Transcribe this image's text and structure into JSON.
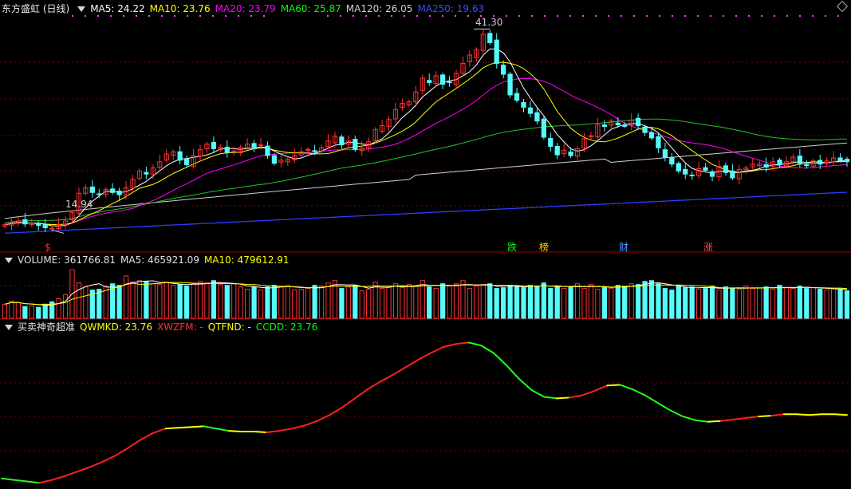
{
  "header": {
    "title": "东方盛虹 (日线)",
    "ma_labels": [
      {
        "text": "MA5: 24.22",
        "color": "#ffffff"
      },
      {
        "text": "MA10: 23.76",
        "color": "#ffff00"
      },
      {
        "text": "MA20: 23.79",
        "color": "#ff00ff"
      },
      {
        "text": "MA60: 25.87",
        "color": "#00ff00"
      },
      {
        "text": "MA120: 26.05",
        "color": "#d0d0d0"
      },
      {
        "text": "MA250: 19.63",
        "color": "#3a4bff"
      }
    ]
  },
  "volume_header": {
    "labels": [
      {
        "text": "VOLUME: 361766.81",
        "color": "#e0e0e0"
      },
      {
        "text": "MA5: 465921.09",
        "color": "#e0e0e0"
      },
      {
        "text": "MA10: 479612.91",
        "color": "#ffff00"
      }
    ]
  },
  "indicator_header": {
    "title": "买卖神奇超准",
    "labels": [
      {
        "text": "QWMKD: 23.76",
        "color": "#ffff00"
      },
      {
        "text": "XWZFM: -",
        "color": "#ff3030"
      },
      {
        "text": "QTFND: -",
        "color": "#ffff00"
      },
      {
        "text": "CCDD: 23.76",
        "color": "#00ff00"
      }
    ]
  },
  "annotations": {
    "high": "41.30",
    "low": "14.94"
  },
  "event_marks": [
    {
      "text": "$",
      "color": "#ff3030"
    },
    {
      "text": "跌",
      "color": "#00ff00"
    },
    {
      "text": "榜",
      "color": "#ffd700"
    },
    {
      "text": "财",
      "color": "#4aa0ff"
    },
    {
      "text": "涨",
      "color": "#ff5050"
    }
  ],
  "colors": {
    "up": "#ff3232",
    "down": "#54fcfc",
    "grid": "#800000"
  },
  "chart_data": {
    "type": "candlestick",
    "ylim": [
      13.5,
      43
    ],
    "closes": [
      15.4,
      15.7,
      15.9,
      15.5,
      15.6,
      15.3,
      15.0,
      14.95,
      15.4,
      15.9,
      17.0,
      19.5,
      20.2,
      19.6,
      19.4,
      20.0,
      19.6,
      19.3,
      20.2,
      21.3,
      22.4,
      22.0,
      22.8,
      23.6,
      24.6,
      24.9,
      23.8,
      23.2,
      24.4,
      25.2,
      25.9,
      25.3,
      25.5,
      24.8,
      25.0,
      25.5,
      25.9,
      25.5,
      25.8,
      24.4,
      23.4,
      23.8,
      23.9,
      24.4,
      24.9,
      25.2,
      25.0,
      25.4,
      26.3,
      26.9,
      25.8,
      26.3,
      25.2,
      25.4,
      26.2,
      27.8,
      28.3,
      29.1,
      30.4,
      31.2,
      31.4,
      32.7,
      34.5,
      33.9,
      34.8,
      33.7,
      33.9,
      35.1,
      36.4,
      37.5,
      38.2,
      40.2,
      39.1,
      36.4,
      35.0,
      32.3,
      31.6,
      30.7,
      29.9,
      28.9,
      26.8,
      25.6,
      24.5,
      25.1,
      24.4,
      25.3,
      26.6,
      27.0,
      28.4,
      28.2,
      28.9,
      28.4,
      28.3,
      29.0,
      28.3,
      27.4,
      26.7,
      25.4,
      24.2,
      23.3,
      22.4,
      22.0,
      21.8,
      22.7,
      22.5,
      21.7,
      23.0,
      22.2,
      21.5,
      22.6,
      22.8,
      23.3,
      23.3,
      22.9,
      23.6,
      23.2,
      23.6,
      24.2,
      23.4,
      23.1,
      23.7,
      23.3,
      23.7,
      24.1,
      23.8,
      23.6
    ],
    "volume": [
      18,
      22,
      20,
      15,
      16,
      14,
      18,
      21,
      25,
      30,
      62,
      45,
      40,
      36,
      37,
      41,
      44,
      42,
      54,
      46,
      48,
      47,
      44,
      43,
      46,
      42,
      43,
      41,
      45,
      47,
      45,
      48,
      43,
      42,
      44,
      40,
      37,
      40,
      36,
      40,
      42,
      41,
      42,
      36,
      37,
      38,
      42,
      41,
      45,
      48,
      38,
      40,
      42,
      35,
      37,
      46,
      38,
      41,
      44,
      39,
      43,
      41,
      48,
      40,
      38,
      44,
      41,
      44,
      48,
      38,
      41,
      43,
      44,
      38,
      39,
      42,
      41,
      39,
      42,
      41,
      45,
      38,
      41,
      38,
      40,
      44,
      38,
      43,
      37,
      40,
      38,
      42,
      41,
      44,
      43,
      47,
      48,
      44,
      38,
      36,
      42,
      39,
      40,
      37,
      38,
      41,
      36,
      40,
      38,
      37,
      41,
      38,
      39,
      40,
      37,
      42,
      39,
      38,
      41,
      38,
      39,
      37,
      36,
      38,
      37,
      35
    ],
    "indicator": [
      16.8,
      16.6,
      16.4,
      16.2,
      16.6,
      17.1,
      17.7,
      18.3,
      19.0,
      19.8,
      20.8,
      21.9,
      22.8,
      23.4,
      23.5,
      23.6,
      23.7,
      23.4,
      23.1,
      23.0,
      23.0,
      22.9,
      23.1,
      23.4,
      23.8,
      24.4,
      25.2,
      26.2,
      27.4,
      28.6,
      29.6,
      30.5,
      31.5,
      32.5,
      33.4,
      34.2,
      34.6,
      34.8,
      34.4,
      33.4,
      31.8,
      30.0,
      28.5,
      27.6,
      27.4,
      27.5,
      27.8,
      28.4,
      29.1,
      29.2,
      28.6,
      27.8,
      26.8,
      25.8,
      25.0,
      24.5,
      24.3,
      24.4,
      24.6,
      24.8,
      25.0,
      25.1,
      25.3,
      25.3,
      25.2,
      25.3,
      25.3,
      25.2
    ],
    "indicator_ylim": [
      15.5,
      36
    ]
  }
}
